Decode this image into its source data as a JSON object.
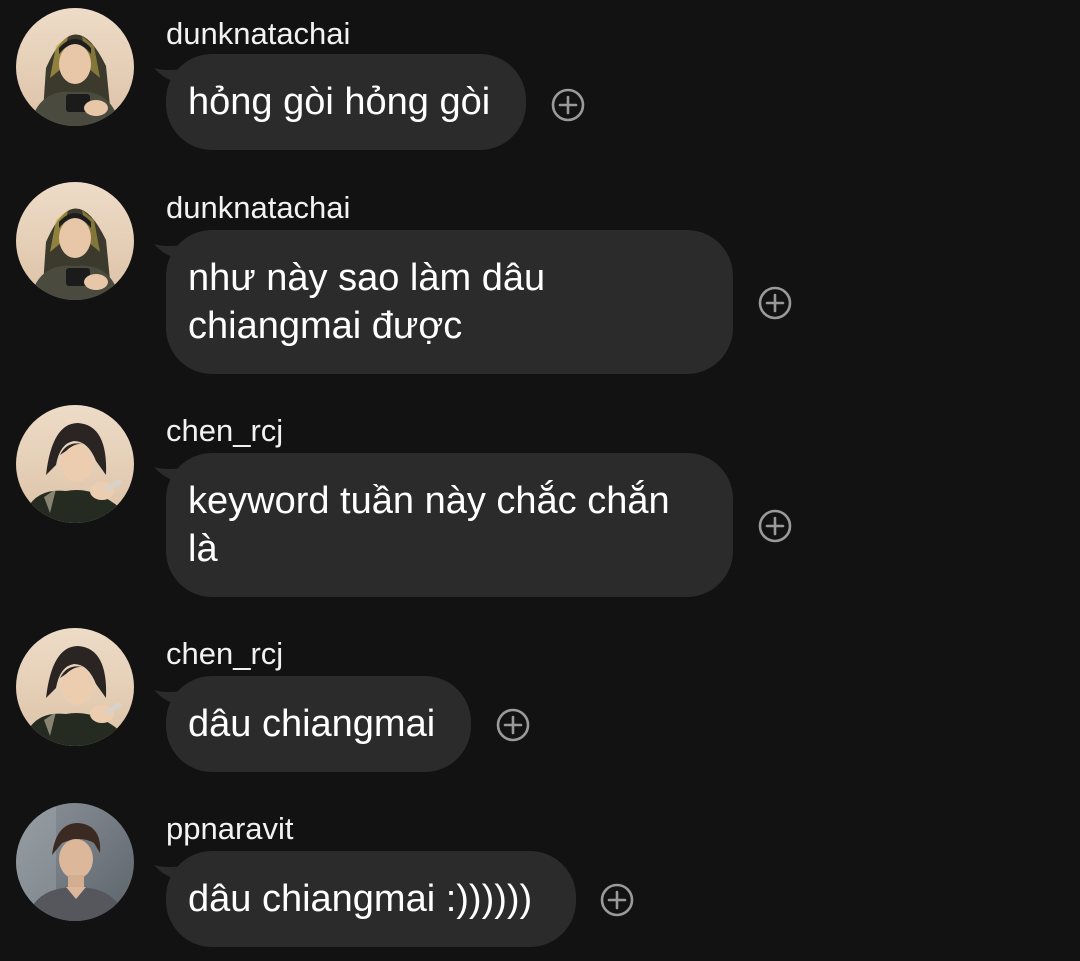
{
  "messages": [
    {
      "username": "dunknatachai",
      "text": "hỏng gòi hỏng gòi",
      "avatar_icon": "profile-photo-dunknatachai"
    },
    {
      "username": "dunknatachai",
      "text": "như này sao làm dâu chiangmai được",
      "avatar_icon": "profile-photo-dunknatachai"
    },
    {
      "username": "chen_rcj",
      "text": "keyword tuần này chắc chắn là",
      "avatar_icon": "profile-photo-chen_rcj"
    },
    {
      "username": "chen_rcj",
      "text": "dâu chiangmai",
      "avatar_icon": "profile-photo-chen_rcj"
    },
    {
      "username": "ppnaravit",
      "text": "dâu chiangmai :))))))",
      "avatar_icon": "profile-photo-ppnaravit"
    }
  ],
  "colors": {
    "background": "#121212",
    "bubble": "#2b2b2b",
    "text": "#ffffff",
    "icon": "#9a9a9a"
  },
  "icons": {
    "reaction": "add-reaction-plus-circle-icon"
  }
}
